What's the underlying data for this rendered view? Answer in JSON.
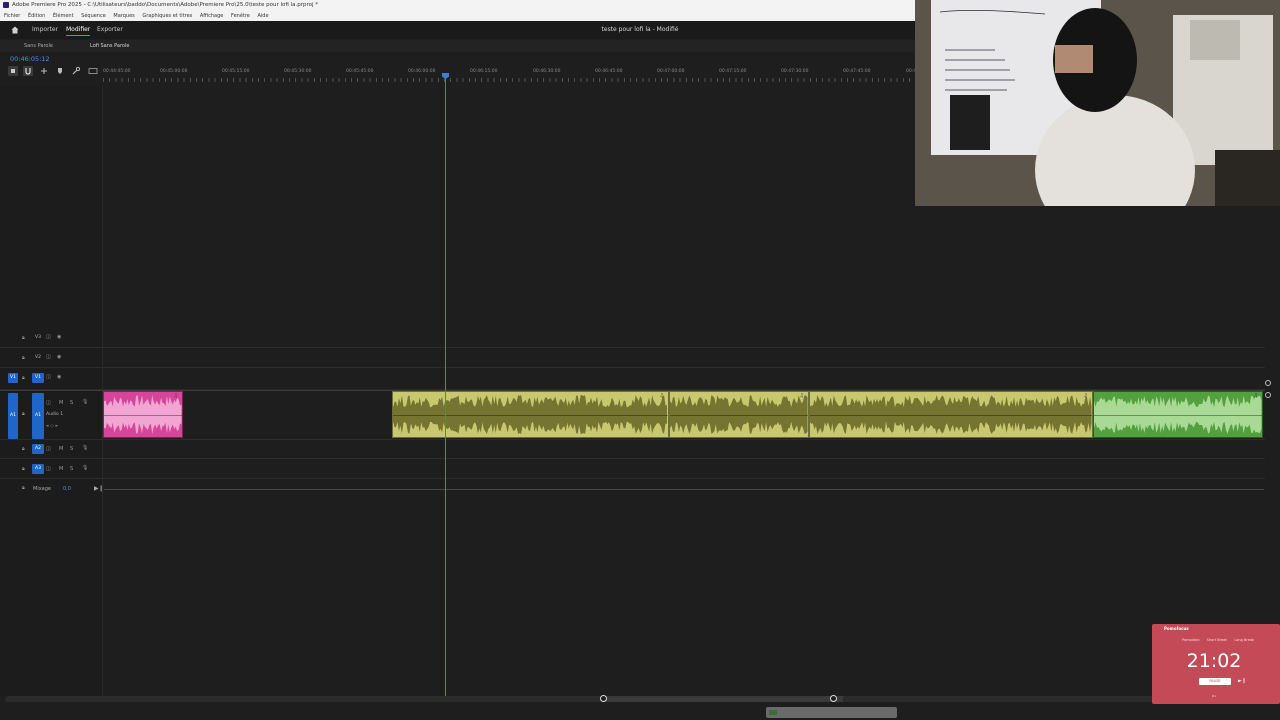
{
  "window": {
    "title": "Adobe Premiere Pro 2025 - C:\\Utilisateurs\\baddo\\Documents\\Adobe\\Premiere Pro\\25.0\\teste pour lofi la.prproj *"
  },
  "menubar": {
    "items": [
      "Fichier",
      "Édition",
      "Élément",
      "Séquence",
      "Marques",
      "Graphiques et titres",
      "Affichage",
      "Fenêtre",
      "Aide"
    ]
  },
  "workspace": {
    "tabs": [
      "Importer",
      "Modifier",
      "Exporter"
    ],
    "active_tab": "Modifier",
    "document_title": "teste pour lofi la - Modifié"
  },
  "sequence_tabs": {
    "items": [
      "Sans Parole",
      "Lofi Sans Parole"
    ],
    "active": "Lofi Sans Parole"
  },
  "timeline": {
    "timecode": "00:46:05:12",
    "ruler_labels": [
      "00:44:45:00",
      "00:45:00:00",
      "00:45:15:00",
      "00:45:30:00",
      "00:45:45:00",
      "00:46:00:00",
      "00:46:15:00",
      "00:46:30:00",
      "00:46:45:00",
      "00:47:00:00",
      "00:47:15:00",
      "00:47:30:00",
      "00:47:45:00",
      "00:48:00:00"
    ],
    "video_tracks": [
      {
        "name": "V3"
      },
      {
        "name": "V2"
      },
      {
        "name": "V1",
        "source": "V1"
      }
    ],
    "audio_tracks": [
      {
        "name": "A1",
        "source": "A1",
        "label": "Audio 1",
        "m": "M",
        "s": "S"
      },
      {
        "name": "A2",
        "m": "M",
        "s": "S"
      },
      {
        "name": "A3",
        "m": "M",
        "s": "S"
      }
    ],
    "mix": {
      "label": "Mixage",
      "value": "0,0"
    },
    "icons": {
      "clip_fx": "fx-badge-icon",
      "lock": "lock-icon",
      "eye": "eye-icon",
      "mic": "microphone-icon"
    },
    "colors": {
      "clip_yellow": "#c8c86e",
      "clip_pink": "#d8449a",
      "clip_green": "#52a03e",
      "playhead": "#3a7fd5",
      "accent": "#1e66c8"
    }
  },
  "widget": {
    "brand": "Pomofocus",
    "tabs": [
      "Pomodoro",
      "Short Break",
      "Long Break"
    ],
    "time": "21:02",
    "button": "PAUSE",
    "footer": "#1"
  }
}
